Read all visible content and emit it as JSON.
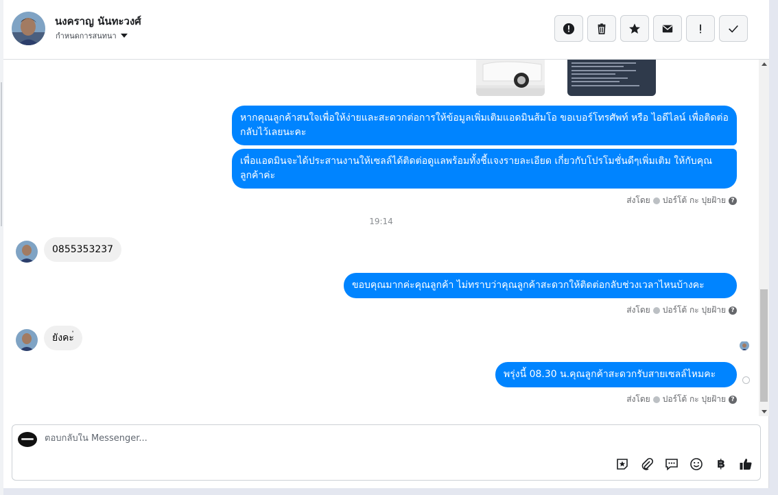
{
  "header": {
    "contact_name": "นงคราญ นันทะวงศ์",
    "subtitle": "กำหนดการสนทนา",
    "actions": [
      "warning-icon",
      "trash-icon",
      "star-icon",
      "mail-icon",
      "exclamation-icon",
      "check-icon"
    ]
  },
  "messages": {
    "out_1": "หากคุณลูกค้าสนใจเพื่อให้ง่ายและสะดวกต่อการให้ข้อมูลเพิ่มเติมแอดมินส้มโอ ขอเบอร์โทรศัพท์ หรือ ไอดีไลน์ เพื่อติดต่อกลับไว้เลยนะคะ",
    "out_2": "เพื่อแอดมินจะได้ประสานงานให้เซลล์ได้ติดต่อดูแลพร้อมทั้งชี้แจงรายละเอียด เกี่ยวกับโปรโมชั่นดีๆเพิ่มเติม ให้กับคุณลูกค้าค่ะ",
    "sent_by_1": "ส่งโดย",
    "sender_1": "ปอร์โต้ กะ ปุยฝ้าย",
    "timestamp": "19:14",
    "in_1": "0855353237",
    "out_3": "ขอบคุณมากค่ะคุณลูกค้า ไม่ทราบว่าคุณลูกค้าสะดวกให้ติดต่อกลับช่วงเวลาไหนบ้างคะ",
    "sent_by_2": "ส่งโดย",
    "sender_2": "ปอร์โต้ กะ ปุยฝ้าย",
    "in_2": "ยังคะ่",
    "out_4": "พรุ่งนี้ 08.30 น.คุณลูกค้าสะดวกรับสายเซลล์ไหมคะ",
    "sent_by_3": "ส่งโดย",
    "sender_3": "ปอร์โต้ กะ ปุยฝ้าย"
  },
  "composer": {
    "placeholder": "ตอบกลับใน Messenger...",
    "tools": [
      "sticker-icon",
      "attachment-icon",
      "saved-reply-icon",
      "emoji-icon",
      "baht-icon",
      "like-icon"
    ],
    "baht_symbol": "฿"
  },
  "colors": {
    "outgoing_bubble": "#0084ff",
    "incoming_bubble": "#f0f0f0"
  }
}
